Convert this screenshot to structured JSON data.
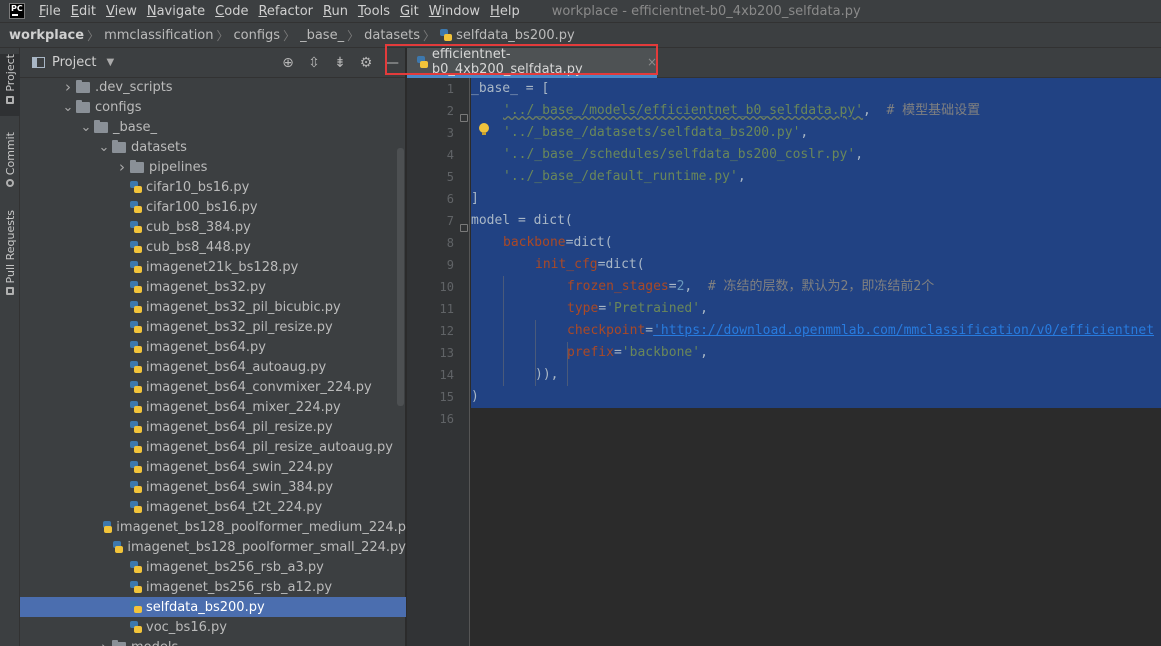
{
  "menubar": {
    "items": [
      "File",
      "Edit",
      "View",
      "Navigate",
      "Code",
      "Refactor",
      "Run",
      "Tools",
      "Git",
      "Window",
      "Help"
    ],
    "window_title": "workplace - efficientnet-b0_4xb200_selfdata.py"
  },
  "breadcrumb": [
    "workplace",
    "mmclassification",
    "configs",
    "_base_",
    "datasets",
    "selfdata_bs200.py"
  ],
  "toolstrip": {
    "tabs": [
      "Project",
      "Commit",
      "Pull Requests"
    ]
  },
  "project_panel": {
    "title": "Project",
    "tree": [
      {
        "label": ".dev_scripts",
        "type": "folder",
        "depth": 1,
        "expanded": false
      },
      {
        "label": "configs",
        "type": "folder",
        "depth": 1,
        "expanded": true
      },
      {
        "label": "_base_",
        "type": "folder",
        "depth": 2,
        "expanded": true
      },
      {
        "label": "datasets",
        "type": "folder",
        "depth": 3,
        "expanded": true
      },
      {
        "label": "pipelines",
        "type": "folder",
        "depth": 4,
        "expanded": false
      },
      {
        "label": "cifar10_bs16.py",
        "type": "file",
        "depth": 4
      },
      {
        "label": "cifar100_bs16.py",
        "type": "file",
        "depth": 4
      },
      {
        "label": "cub_bs8_384.py",
        "type": "file",
        "depth": 4
      },
      {
        "label": "cub_bs8_448.py",
        "type": "file",
        "depth": 4
      },
      {
        "label": "imagenet21k_bs128.py",
        "type": "file",
        "depth": 4
      },
      {
        "label": "imagenet_bs32.py",
        "type": "file",
        "depth": 4
      },
      {
        "label": "imagenet_bs32_pil_bicubic.py",
        "type": "file",
        "depth": 4
      },
      {
        "label": "imagenet_bs32_pil_resize.py",
        "type": "file",
        "depth": 4
      },
      {
        "label": "imagenet_bs64.py",
        "type": "file",
        "depth": 4
      },
      {
        "label": "imagenet_bs64_autoaug.py",
        "type": "file",
        "depth": 4
      },
      {
        "label": "imagenet_bs64_convmixer_224.py",
        "type": "file",
        "depth": 4
      },
      {
        "label": "imagenet_bs64_mixer_224.py",
        "type": "file",
        "depth": 4
      },
      {
        "label": "imagenet_bs64_pil_resize.py",
        "type": "file",
        "depth": 4
      },
      {
        "label": "imagenet_bs64_pil_resize_autoaug.py",
        "type": "file",
        "depth": 4
      },
      {
        "label": "imagenet_bs64_swin_224.py",
        "type": "file",
        "depth": 4
      },
      {
        "label": "imagenet_bs64_swin_384.py",
        "type": "file",
        "depth": 4
      },
      {
        "label": "imagenet_bs64_t2t_224.py",
        "type": "file",
        "depth": 4
      },
      {
        "label": "imagenet_bs128_poolformer_medium_224.p",
        "type": "file",
        "depth": 4
      },
      {
        "label": "imagenet_bs128_poolformer_small_224.py",
        "type": "file",
        "depth": 4
      },
      {
        "label": "imagenet_bs256_rsb_a3.py",
        "type": "file",
        "depth": 4
      },
      {
        "label": "imagenet_bs256_rsb_a12.py",
        "type": "file",
        "depth": 4
      },
      {
        "label": "selfdata_bs200.py",
        "type": "file",
        "depth": 4,
        "selected": true
      },
      {
        "label": "voc_bs16.py",
        "type": "file",
        "depth": 4
      },
      {
        "label": "models",
        "type": "folder",
        "depth": 3,
        "expanded": false
      }
    ]
  },
  "editor": {
    "tab_label": "efficientnet-b0_4xb200_selfdata.py",
    "tab_close": "×",
    "line_numbers": [
      "1",
      "2",
      "3",
      "4",
      "5",
      "6",
      "7",
      "8",
      "9",
      "10",
      "11",
      "12",
      "13",
      "14",
      "15",
      "16"
    ],
    "code": {
      "l1": "_base_ = [",
      "l2_str": "'../_base_/models/efficientnet_b0_selfdata.py'",
      "l2_cmt": "# 模型基础设置",
      "l3_str": "'../_base_/datasets/selfdata_bs200.py'",
      "l4_str": "'../_base_/schedules/selfdata_bs200_coslr.py'",
      "l5_str": "'../_base_/default_runtime.py'",
      "l6": "]",
      "l7": "model = dict(",
      "l8_kw": "backbone",
      "l8_rest": "=dict(",
      "l9_kw": "init_cfg",
      "l9_rest": "=dict(",
      "l10_kw": "frozen_stages",
      "l10_num": "2",
      "l10_cmt": "# 冻结的层数，默认为2，即冻结前2个",
      "l11_kw": "type",
      "l11_str": "'Pretrained'",
      "l12_kw": "checkpoint",
      "l12_url": "'https://download.openmmlab.com/mmclassification/v0/efficientnet",
      "l13_kw": "prefix",
      "l13_str": "'backbone'",
      "l14": ")),",
      "l15": ")"
    }
  }
}
